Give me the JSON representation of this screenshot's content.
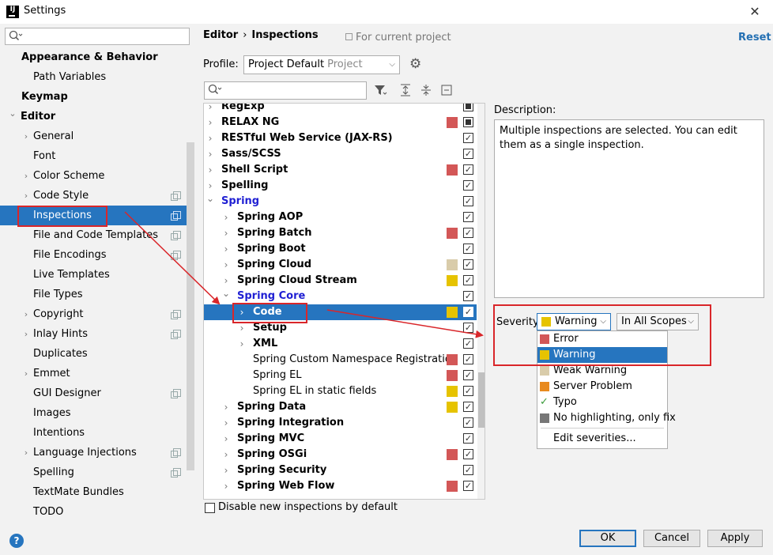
{
  "window": {
    "title": "Settings",
    "app_icon_text": "IJ",
    "close": "✕"
  },
  "sidebar": {
    "search_placeholder": "",
    "items": [
      {
        "label": "Appearance & Behavior",
        "bold": true,
        "indent": 0,
        "arrow": "",
        "copy": false
      },
      {
        "label": "Path Variables",
        "bold": false,
        "indent": 2,
        "arrow": "",
        "copy": false
      },
      {
        "label": "Keymap",
        "bold": true,
        "indent": 0,
        "arrow": "",
        "copy": false
      },
      {
        "label": "Editor",
        "bold": true,
        "indent": 0,
        "arrow": "expanded",
        "copy": false
      },
      {
        "label": "General",
        "bold": false,
        "indent": 2,
        "arrow": "collapsed",
        "copy": false
      },
      {
        "label": "Font",
        "bold": false,
        "indent": 2,
        "arrow": "",
        "copy": false
      },
      {
        "label": "Color Scheme",
        "bold": false,
        "indent": 2,
        "arrow": "collapsed",
        "copy": false
      },
      {
        "label": "Code Style",
        "bold": false,
        "indent": 2,
        "arrow": "collapsed",
        "copy": true
      },
      {
        "label": "Inspections",
        "bold": false,
        "indent": 2,
        "arrow": "",
        "copy": true,
        "selected": true
      },
      {
        "label": "File and Code Templates",
        "bold": false,
        "indent": 2,
        "arrow": "",
        "copy": true
      },
      {
        "label": "File Encodings",
        "bold": false,
        "indent": 2,
        "arrow": "",
        "copy": true
      },
      {
        "label": "Live Templates",
        "bold": false,
        "indent": 2,
        "arrow": "",
        "copy": false
      },
      {
        "label": "File Types",
        "bold": false,
        "indent": 2,
        "arrow": "",
        "copy": false
      },
      {
        "label": "Copyright",
        "bold": false,
        "indent": 2,
        "arrow": "collapsed",
        "copy": true
      },
      {
        "label": "Inlay Hints",
        "bold": false,
        "indent": 2,
        "arrow": "collapsed",
        "copy": true
      },
      {
        "label": "Duplicates",
        "bold": false,
        "indent": 2,
        "arrow": "",
        "copy": false
      },
      {
        "label": "Emmet",
        "bold": false,
        "indent": 2,
        "arrow": "collapsed",
        "copy": false
      },
      {
        "label": "GUI Designer",
        "bold": false,
        "indent": 2,
        "arrow": "",
        "copy": true
      },
      {
        "label": "Images",
        "bold": false,
        "indent": 2,
        "arrow": "",
        "copy": false
      },
      {
        "label": "Intentions",
        "bold": false,
        "indent": 2,
        "arrow": "",
        "copy": false
      },
      {
        "label": "Language Injections",
        "bold": false,
        "indent": 2,
        "arrow": "collapsed",
        "copy": true
      },
      {
        "label": "Spelling",
        "bold": false,
        "indent": 2,
        "arrow": "",
        "copy": true
      },
      {
        "label": "TextMate Bundles",
        "bold": false,
        "indent": 2,
        "arrow": "",
        "copy": false
      },
      {
        "label": "TODO",
        "bold": false,
        "indent": 2,
        "arrow": "",
        "copy": false
      }
    ]
  },
  "header": {
    "breadcrumb_editor": "Editor",
    "breadcrumb_sep": "›",
    "breadcrumb_inspections": "Inspections",
    "for_project": "For current project",
    "reset": "Reset"
  },
  "profile": {
    "label": "Profile:",
    "value": "Project Default",
    "sub": "Project"
  },
  "tree": {
    "rows": [
      {
        "label": "RegExp",
        "style": "bold",
        "level": 0,
        "arrow": "collapsed",
        "sev": "",
        "check": "mixed"
      },
      {
        "label": "RELAX NG",
        "style": "bold",
        "level": 0,
        "arrow": "collapsed",
        "sev": "error",
        "check": "mixed"
      },
      {
        "label": "RESTful Web Service (JAX-RS)",
        "style": "bold",
        "level": 0,
        "arrow": "collapsed",
        "sev": "",
        "check": "checked"
      },
      {
        "label": "Sass/SCSS",
        "style": "bold",
        "level": 0,
        "arrow": "collapsed",
        "sev": "",
        "check": "checked"
      },
      {
        "label": "Shell Script",
        "style": "bold",
        "level": 0,
        "arrow": "collapsed",
        "sev": "error",
        "check": "checked"
      },
      {
        "label": "Spelling",
        "style": "bold",
        "level": 0,
        "arrow": "collapsed",
        "sev": "",
        "check": "checked"
      },
      {
        "label": "Spring",
        "style": "blue",
        "level": 0,
        "arrow": "expanded",
        "sev": "",
        "check": "checked"
      },
      {
        "label": "Spring AOP",
        "style": "bold",
        "level": 1,
        "arrow": "collapsed",
        "sev": "",
        "check": "checked"
      },
      {
        "label": "Spring Batch",
        "style": "bold",
        "level": 1,
        "arrow": "collapsed",
        "sev": "error",
        "check": "checked"
      },
      {
        "label": "Spring Boot",
        "style": "bold",
        "level": 1,
        "arrow": "collapsed",
        "sev": "",
        "check": "checked"
      },
      {
        "label": "Spring Cloud",
        "style": "bold",
        "level": 1,
        "arrow": "collapsed",
        "sev": "weak",
        "check": "checked"
      },
      {
        "label": "Spring Cloud Stream",
        "style": "bold",
        "level": 1,
        "arrow": "collapsed",
        "sev": "warning",
        "check": "checked"
      },
      {
        "label": "Spring Core",
        "style": "blue",
        "level": 1,
        "arrow": "expanded",
        "sev": "",
        "check": "checked"
      },
      {
        "label": "Code",
        "style": "bold",
        "level": 2,
        "arrow": "collapsed",
        "sev": "warning",
        "check": "checked",
        "selected": true
      },
      {
        "label": "Setup",
        "style": "bold",
        "level": 2,
        "arrow": "collapsed",
        "sev": "",
        "check": "checked"
      },
      {
        "label": "XML",
        "style": "bold",
        "level": 2,
        "arrow": "collapsed",
        "sev": "",
        "check": "checked"
      },
      {
        "label": "Spring Custom Namespace Registration",
        "style": "normal",
        "level": 2,
        "arrow": "",
        "sev": "error",
        "check": "checked"
      },
      {
        "label": "Spring EL",
        "style": "normal",
        "level": 2,
        "arrow": "",
        "sev": "error",
        "check": "checked"
      },
      {
        "label": "Spring EL in static fields",
        "style": "normal",
        "level": 2,
        "arrow": "",
        "sev": "warning",
        "check": "checked"
      },
      {
        "label": "Spring Data",
        "style": "bold",
        "level": 1,
        "arrow": "collapsed",
        "sev": "warning",
        "check": "checked"
      },
      {
        "label": "Spring Integration",
        "style": "bold",
        "level": 1,
        "arrow": "collapsed",
        "sev": "",
        "check": "checked"
      },
      {
        "label": "Spring MVC",
        "style": "bold",
        "level": 1,
        "arrow": "collapsed",
        "sev": "",
        "check": "checked"
      },
      {
        "label": "Spring OSGi",
        "style": "bold",
        "level": 1,
        "arrow": "collapsed",
        "sev": "error",
        "check": "checked"
      },
      {
        "label": "Spring Security",
        "style": "bold",
        "level": 1,
        "arrow": "collapsed",
        "sev": "",
        "check": "checked"
      },
      {
        "label": "Spring Web Flow",
        "style": "bold",
        "level": 1,
        "arrow": "collapsed",
        "sev": "error",
        "check": "checked"
      }
    ],
    "disable_new": "Disable new inspections by default"
  },
  "description": {
    "label": "Description:",
    "text": "Multiple inspections are selected. You can edit them as a single inspection."
  },
  "severity": {
    "label": "Severity:",
    "value": "Warning",
    "scope": "In All Scopes",
    "options": [
      {
        "label": "Error",
        "color": "#d35757"
      },
      {
        "label": "Warning",
        "color": "#e6c300",
        "selected": true
      },
      {
        "label": "Weak Warning",
        "color": "#d9ccaa"
      },
      {
        "label": "Server Problem",
        "color": "#e88a1e"
      },
      {
        "label": "Typo",
        "color": "",
        "icon": "typo-check-icon"
      },
      {
        "label": "No highlighting, only fix",
        "color": "#777777"
      }
    ],
    "edit": "Edit severities..."
  },
  "colors": {
    "error": "#d35757",
    "warning": "#e6c300",
    "weak": "#d9ccaa",
    "selection": "#2675bf",
    "annotation": "#d9262a"
  },
  "buttons": {
    "ok": "OK",
    "cancel": "Cancel",
    "apply": "Apply",
    "help": "?"
  }
}
